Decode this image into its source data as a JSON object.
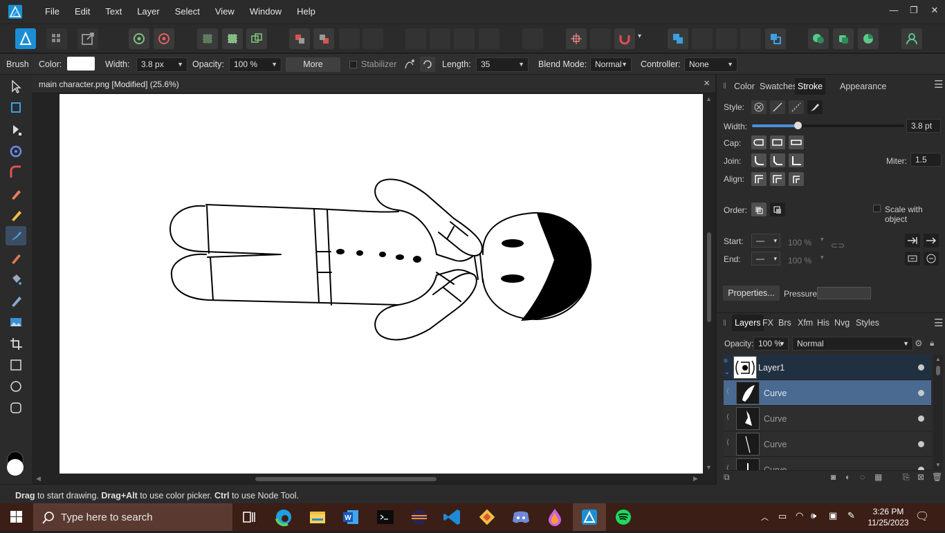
{
  "menubar": {
    "items": [
      "File",
      "Edit",
      "Text",
      "Layer",
      "Select",
      "View",
      "Window",
      "Help"
    ],
    "window_controls": [
      "minimize",
      "restore",
      "close"
    ]
  },
  "context_bar": {
    "tool_name": "Brush",
    "color_label": "Color:",
    "width_label": "Width:",
    "width_value": "3.8 px",
    "opacity_label": "Opacity:",
    "opacity_value": "100 %",
    "more_label": "More",
    "stabilizer_label": "Stabilizer",
    "length_label": "Length:",
    "length_value": "35",
    "blend_label": "Blend Mode:",
    "blend_value": "Normal",
    "controller_label": "Controller:",
    "controller_value": "None"
  },
  "document": {
    "title": "main character.png [Modified] (25.6%)",
    "close": "×"
  },
  "status_bar": {
    "part1_bold": "Drag",
    "part1": " to start drawing. ",
    "part2_bold": "Drag+Alt",
    "part2": " to use color picker. ",
    "part3_bold": "Ctrl",
    "part3": " to use Node Tool."
  },
  "stroke_panel": {
    "tabs": [
      "Color",
      "Swatches",
      "Stroke",
      "Appearance"
    ],
    "active_tab": "Stroke",
    "style_label": "Style:",
    "width_label": "Width:",
    "width_value": "3.8 pt",
    "width_level": 0.3,
    "cap_label": "Cap:",
    "join_label": "Join:",
    "miter_label": "Miter:",
    "miter_value": "1.5",
    "align_label": "Align:",
    "order_label": "Order:",
    "scale_label": "Scale with object",
    "start_label": "Start:",
    "start_pct": "100 %",
    "end_label": "End:",
    "end_pct": "100 %",
    "properties_label": "Properties...",
    "pressure_label": "Pressure:"
  },
  "layers_panel": {
    "tabs": [
      "Layers",
      "FX",
      "Brs",
      "Xfm",
      "His",
      "Nvg",
      "Styles"
    ],
    "active_tab": "Layers",
    "opacity_label": "Opacity:",
    "opacity_value": "100 %",
    "blend_value": "Normal",
    "layers": [
      {
        "name": "Layer1",
        "kind": "parent"
      },
      {
        "name": "Curve",
        "kind": "selected"
      },
      {
        "name": "Curve",
        "kind": "child"
      },
      {
        "name": "Curve",
        "kind": "child"
      },
      {
        "name": "Curve",
        "kind": "child"
      }
    ]
  },
  "taskbar": {
    "search_placeholder": "Type here to search",
    "time": "3:26 PM",
    "date": "11/25/2023",
    "apps": [
      "task-view",
      "edge",
      "file-explorer",
      "word",
      "terminal",
      "eclipse",
      "vscode",
      "git",
      "discord",
      "affinity-photo",
      "affinity-designer",
      "spotify"
    ]
  },
  "colors": {
    "accent": "#4a6a92",
    "brand": "#1b8fd6",
    "taskbar": "#3b1e16"
  }
}
